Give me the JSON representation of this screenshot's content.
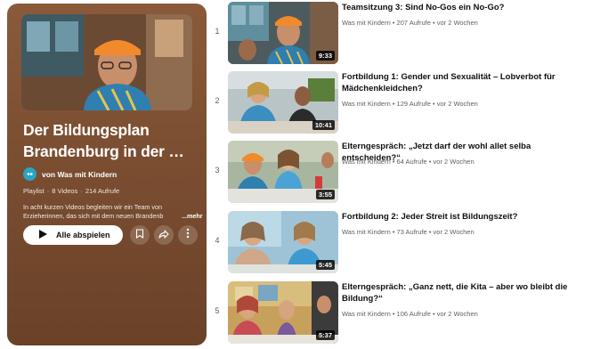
{
  "playlist": {
    "title": "Der Bildungsplan Brandenburg in der …",
    "channel": "von Was mit Kindern",
    "type": "Playlist",
    "video_count": "8 Videos",
    "views": "214 Aufrufe",
    "separator": "·",
    "description": "In acht kurzen Videos begleiten wir ein Team von Erzieherinnen, das sich mit dem neuen Brandenb",
    "more": "...mehr",
    "play_all": "Alle abspielen",
    "icons": [
      "play-icon",
      "save-icon",
      "share-icon",
      "more-vertical-icon"
    ]
  },
  "videos": [
    {
      "index": "1",
      "title": "Teamsitzung 3: Sind No-Gos ein No-Go?",
      "meta": "Was mit Kindern • 207 Aufrufe • vor 2 Wochen",
      "duration": "9:33"
    },
    {
      "index": "2",
      "title": "Fortbildung 1: Gender und Sexualität – Lobverbot für Mädchenkleidchen?",
      "meta": "Was mit Kindern • 129 Aufrufe • vor 2 Wochen",
      "duration": "10:41"
    },
    {
      "index": "3",
      "title": "Elterngespräch: „Jetzt darf der wohl allet selba entscheiden?“",
      "meta": "Was mit Kindern • 64 Aufrufe • vor 2 Wochen",
      "duration": "3:55"
    },
    {
      "index": "4",
      "title": "Fortbildung 2: Jeder Streit ist Bildungszeit?",
      "meta": "Was mit Kindern • 73 Aufrufe • vor 2 Wochen",
      "duration": "5:45"
    },
    {
      "index": "5",
      "title": "Elterngespräch: „Ganz nett, die Kita – aber wo bleibt die Bildung?“",
      "meta": "Was mit Kindern • 106 Aufrufe • vor 2 Wochen",
      "duration": "5:37"
    }
  ],
  "colors": {
    "panel_top": "#8a5a3a",
    "panel_bottom": "#6a4228",
    "channel_avatar": "#25a6c9",
    "title_text": "#0f0f0f",
    "meta_text": "#606060"
  }
}
